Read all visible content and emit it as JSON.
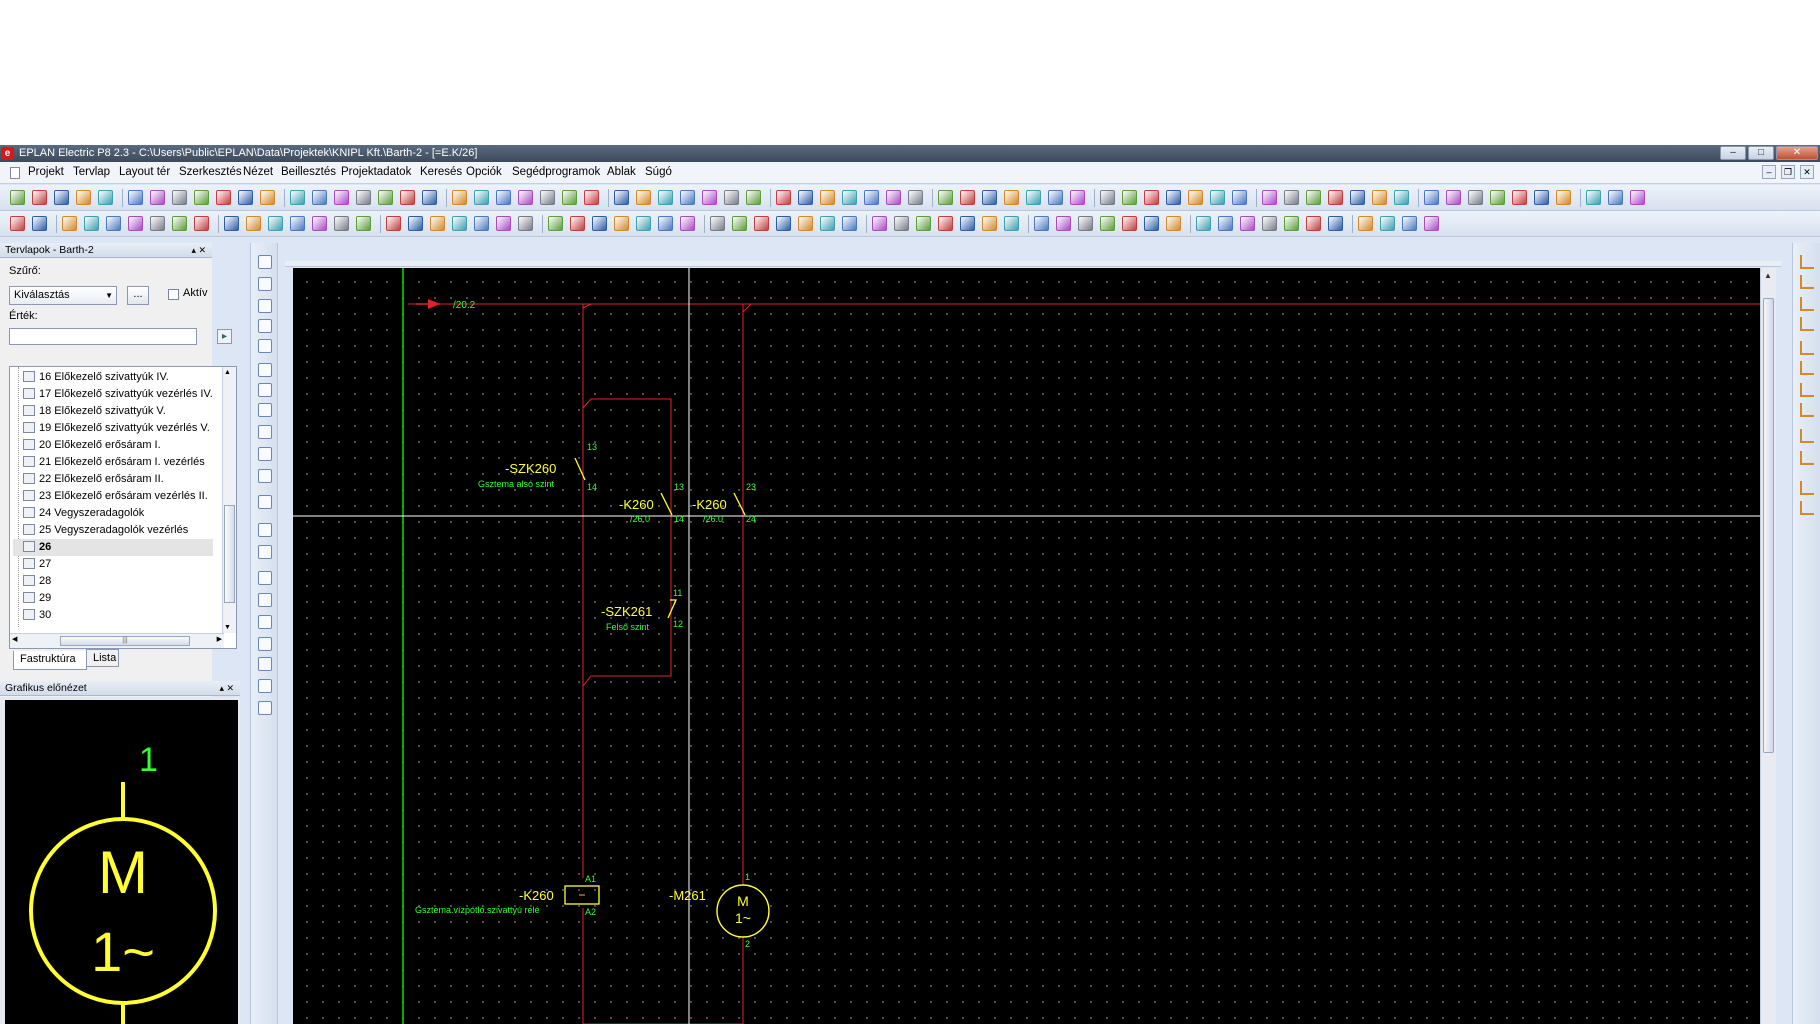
{
  "window": {
    "title": "EPLAN Electric P8 2.3 - C:\\Users\\Public\\EPLAN\\Data\\Projektek\\KNIPL Kft.\\Barth-2 - [=E.K/26]",
    "logo_letter": "e",
    "min_label": "–",
    "max_label": "□",
    "close_label": "✕"
  },
  "menu": {
    "items": [
      "Projekt",
      "Tervlap",
      "Layout tér",
      "Szerkesztés",
      "Nézet",
      "Beillesztés",
      "Projektadatok",
      "Keresés",
      "Opciók",
      "Segédprogramok",
      "Ablak",
      "Súgó"
    ],
    "mdi_min": "–",
    "mdi_restore": "❐",
    "mdi_close": "✕"
  },
  "pages_panel": {
    "title": "Tervlapok - Barth-2",
    "controls": "▴ ✕",
    "filter_label": "Szűrő:",
    "filter_value": "Kiválasztás",
    "browse_label": "...",
    "active_label": "Aktív",
    "value_label": "Érték:",
    "value_text": "",
    "go_label": "▸",
    "tree": [
      {
        "label": "16 Előkezelő szivattyúk IV.",
        "selected": false
      },
      {
        "label": "17 Előkezelő szivattyúk vezérlés IV.",
        "selected": false
      },
      {
        "label": "18 Előkezelő szivattyúk V.",
        "selected": false
      },
      {
        "label": "19 Előkezelő szivattyúk vezérlés V.",
        "selected": false
      },
      {
        "label": "20 Előkezelő erősáram I.",
        "selected": false
      },
      {
        "label": "21 Előkezelő erősáram I. vezérlés",
        "selected": false
      },
      {
        "label": "22 Előkezelő erősáram II.",
        "selected": false
      },
      {
        "label": "23 Előkezelő erősáram vezérlés II.",
        "selected": false
      },
      {
        "label": "24 Vegyszeradagolók",
        "selected": false
      },
      {
        "label": "25 Vegyszeradagolók vezérlés",
        "selected": false
      },
      {
        "label": "26",
        "selected": true
      },
      {
        "label": "27",
        "selected": false
      },
      {
        "label": "28",
        "selected": false
      },
      {
        "label": "29",
        "selected": false
      },
      {
        "label": "30",
        "selected": false
      }
    ],
    "tabs": [
      "Fastruktúra",
      "Lista"
    ],
    "hscroll_grip": "|||"
  },
  "preview_panel": {
    "title": "Grafikus előnézet",
    "controls": "▴ ✕",
    "pin_number": "1",
    "motor_letter": "M",
    "motor_phase": "1~"
  },
  "schematic": {
    "crossref_arrow": "/20.2",
    "szk260": {
      "tag": "-SZK260",
      "desc": "Gsztema alsó szint",
      "pin_top": "13",
      "pin_bottom": "14"
    },
    "k260_contact_a": {
      "tag": "-K260",
      "ref": "/26.0",
      "pin_top": "13",
      "pin_bottom": "14"
    },
    "k260_contact_b": {
      "tag": "-K260",
      "ref": "/26.0",
      "pin_top": "23",
      "pin_bottom": "24"
    },
    "szk261": {
      "tag": "-SZK261",
      "desc": "Felső szint",
      "pin_top": "11",
      "pin_bottom": "12"
    },
    "k260_coil": {
      "tag": "-K260",
      "desc": "Gsztema.vízpótló.szivattyú relé",
      "pin_top": "A1",
      "pin_bottom": "A2"
    },
    "motor": {
      "tag": "-M261",
      "letter": "M",
      "phase": "1~",
      "pin_top": "1",
      "pin_bottom": "2"
    }
  },
  "colors": {
    "canvas_bg": "#000000",
    "wire": "#e0252a",
    "device_text": "#ffff33",
    "pin_text": "#33ff33",
    "potential_line": "#00e000",
    "crosshair": "#ffffff"
  },
  "icons": {
    "toolbar": "toolbar-icons",
    "left_strip": "drawing-tool-icons",
    "right_strip": "connection-symbol-icons"
  }
}
